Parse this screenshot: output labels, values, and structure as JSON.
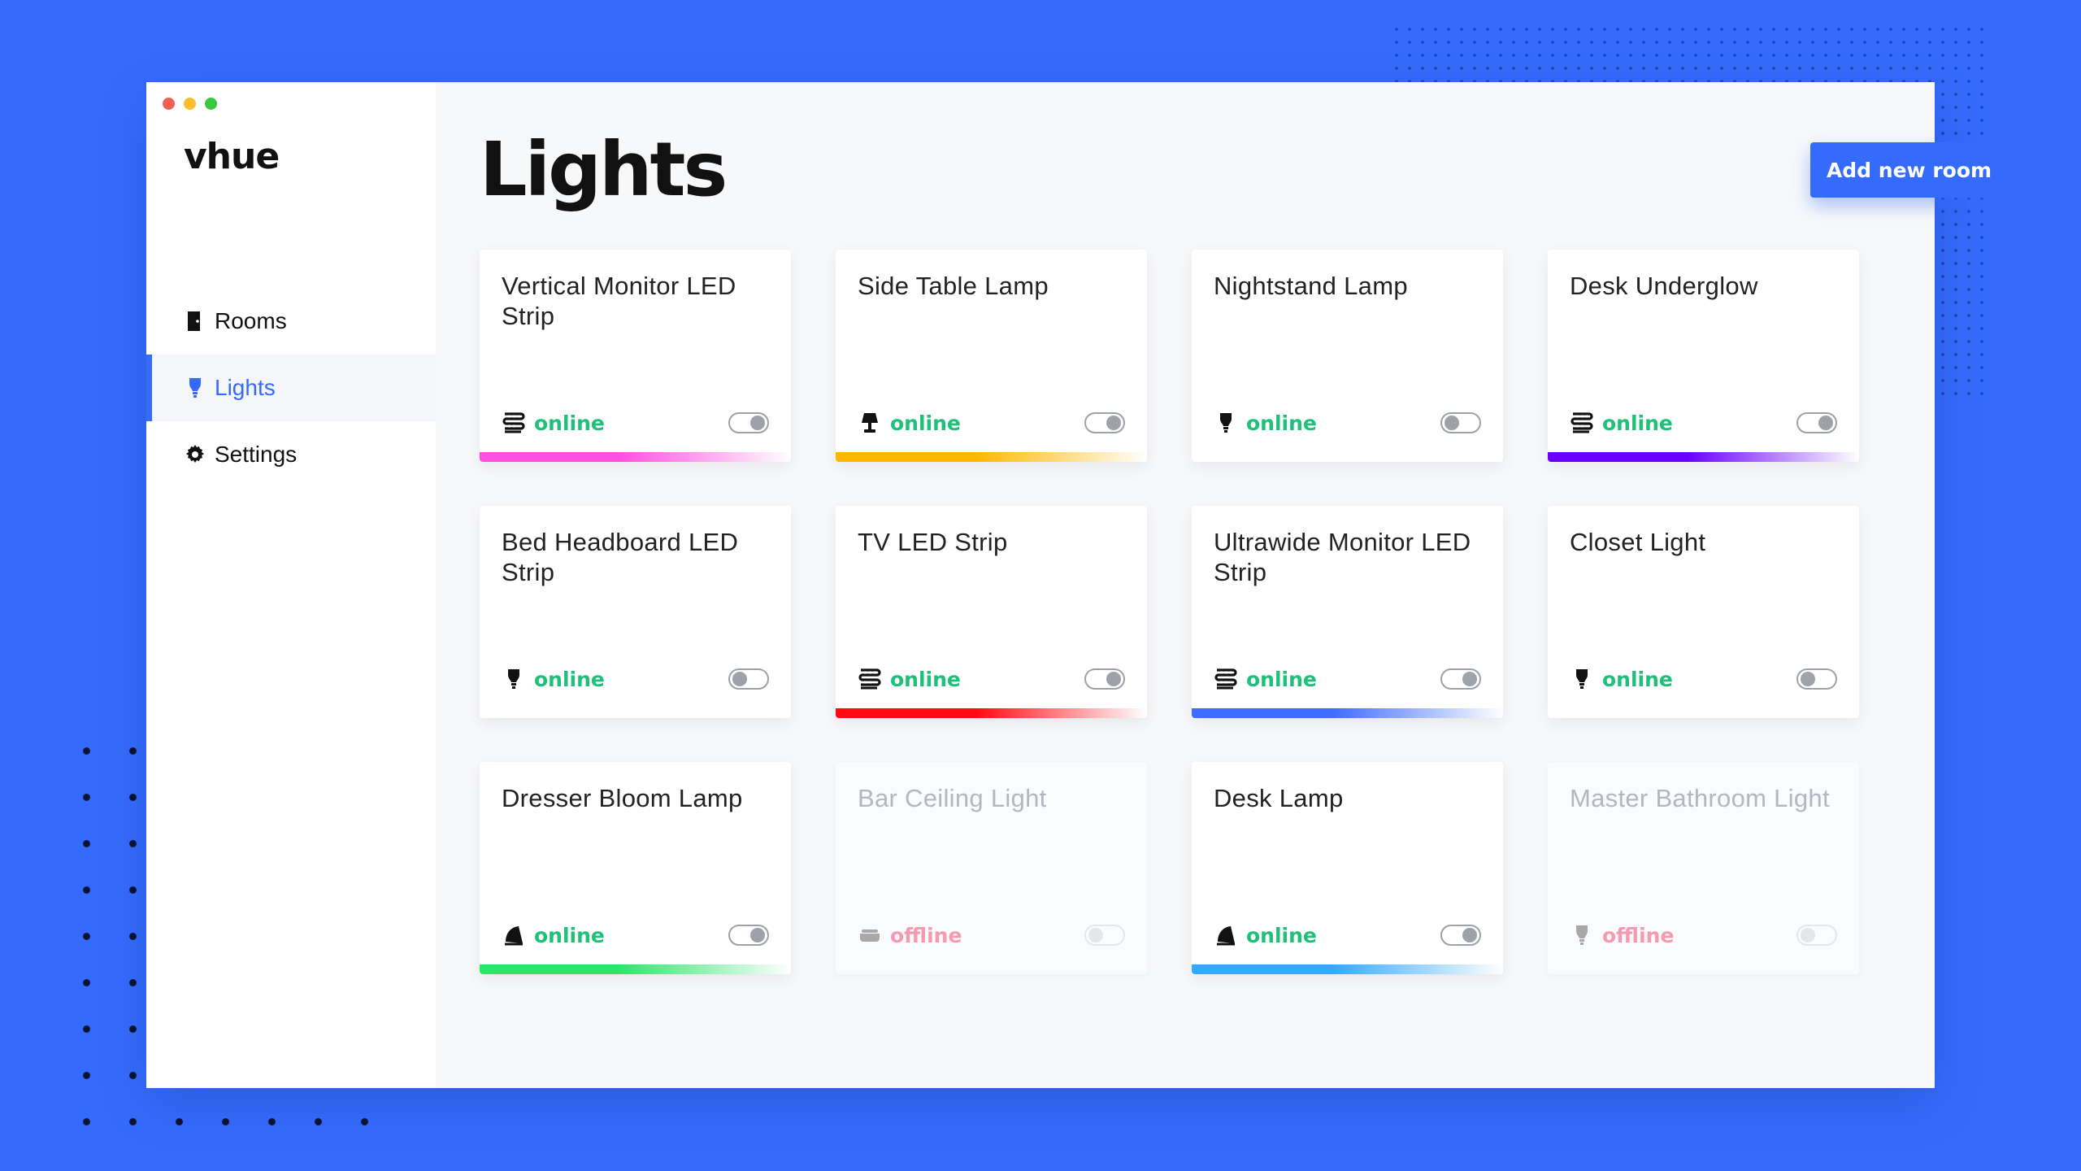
{
  "app": {
    "name": "vhue",
    "traffic_colors": [
      "#f25f58",
      "#fbbe2e",
      "#39c840"
    ]
  },
  "sidebar": {
    "items": [
      {
        "label": "Rooms",
        "icon": "door-icon",
        "active": false
      },
      {
        "label": "Lights",
        "icon": "bulb-icon",
        "active": true
      },
      {
        "label": "Settings",
        "icon": "gear-icon",
        "active": false
      }
    ]
  },
  "main": {
    "title": "Lights",
    "add_button_label": "Add new room"
  },
  "accent_color": "#356bfd",
  "lights": [
    {
      "name": "Vertical Monitor LED Strip",
      "type": "led-strip",
      "status": "online",
      "on": true,
      "color": "#ff4fe2"
    },
    {
      "name": "Side Table Lamp",
      "type": "table-lamp",
      "status": "online",
      "on": true,
      "color": "#ffb800"
    },
    {
      "name": "Nightstand Lamp",
      "type": "bulb",
      "status": "online",
      "on": false,
      "color": null
    },
    {
      "name": "Desk Underglow",
      "type": "led-strip",
      "status": "online",
      "on": true,
      "color": "#6a00ff"
    },
    {
      "name": "Bed Headboard LED Strip",
      "type": "bulb",
      "status": "online",
      "on": false,
      "color": null
    },
    {
      "name": "TV LED Strip",
      "type": "led-strip",
      "status": "online",
      "on": true,
      "color": "#ff0a14"
    },
    {
      "name": "Ultrawide Monitor LED Strip",
      "type": "led-strip",
      "status": "online",
      "on": true,
      "color": "#3f6bff"
    },
    {
      "name": "Closet Light",
      "type": "bulb",
      "status": "online",
      "on": false,
      "color": null
    },
    {
      "name": "Dresser Bloom Lamp",
      "type": "bloom-lamp",
      "status": "online",
      "on": true,
      "color": "#2ee56b"
    },
    {
      "name": "Bar Ceiling Light",
      "type": "ceiling",
      "status": "offline",
      "on": false,
      "color": null
    },
    {
      "name": "Desk Lamp",
      "type": "bloom-lamp",
      "status": "online",
      "on": true,
      "color": "#33aaff"
    },
    {
      "name": "Master Bathroom Light",
      "type": "bulb",
      "status": "offline",
      "on": false,
      "color": null
    }
  ]
}
